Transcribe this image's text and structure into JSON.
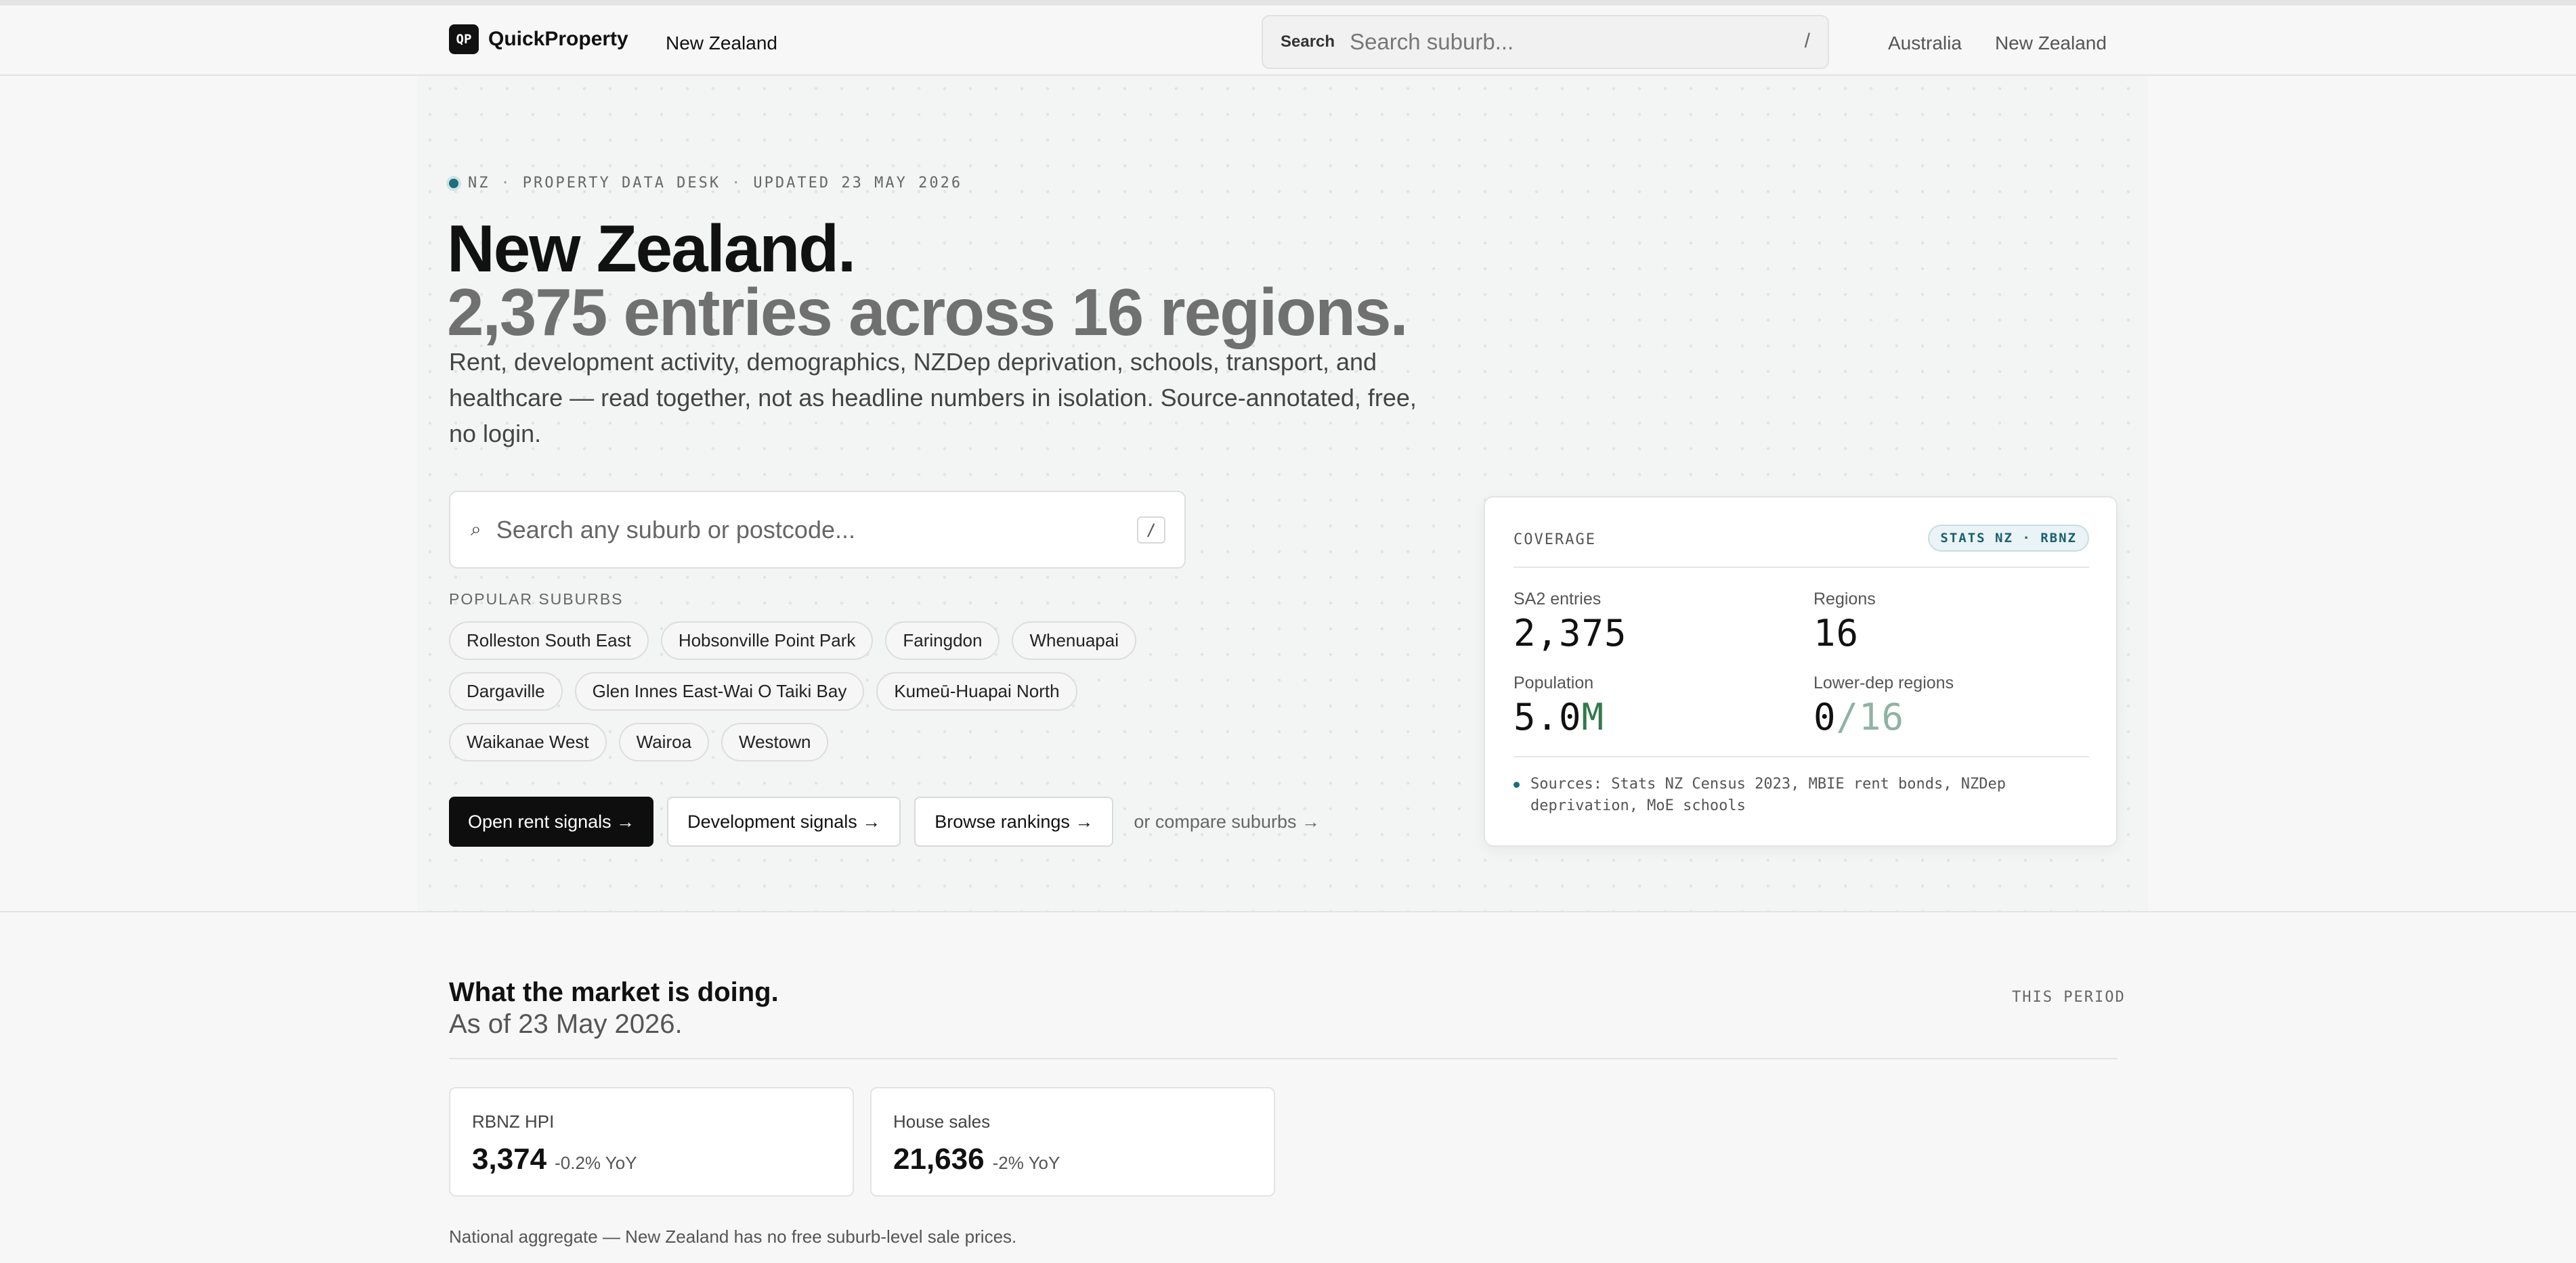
{
  "nav": {
    "brand_logo": "QP",
    "brand_name": "QuickProperty",
    "region": "New Zealand",
    "search_label": "Search",
    "search_placeholder": "Search suburb...",
    "search_shortcut": "/",
    "countries": [
      "Australia",
      "New Zealand"
    ]
  },
  "hero": {
    "eyebrow_parts": [
      "NZ",
      "PROPERTY DATA DESK",
      "UPDATED 23 MAY 2026"
    ],
    "eyebrow_sep": "·",
    "title": "New Zealand.",
    "subtitle": "2,375 entries across 16 regions.",
    "lede": "Rent, development activity, demographics, NZDep deprivation, schools, transport, and healthcare — read together, not as headline numbers in isolation. Source-annotated, free, no login.",
    "search_icon": "⌕",
    "search_placeholder": "Search any suburb or postcode...",
    "search_shortcut": "/",
    "popular_label": "POPULAR SUBURBS",
    "popular_suburbs": [
      [
        "Rolleston South East",
        "Hobsonville Point Park",
        "Faringdon",
        "Whenuapai"
      ],
      [
        "Dargaville",
        "Glen Innes East-Wai O Taiki Bay",
        "Kumeū-Huapai North"
      ],
      [
        "Waikanae West",
        "Wairoa",
        "Westown"
      ]
    ],
    "buttons": {
      "rent": "Open rent signals →",
      "development": "Development signals →",
      "rankings": "Browse rankings →"
    },
    "compare_link": "or compare suburbs →"
  },
  "coverage": {
    "heading": "COVERAGE",
    "badge": "STATS NZ · RBNZ",
    "stats": {
      "sa2_label": "SA2 entries",
      "sa2_value": "2,375",
      "regions_label": "Regions",
      "regions_value": "16",
      "population_label": "Population",
      "population_number": "5.0",
      "population_unit": "M",
      "lowdep_label": "Lower-dep regions",
      "lowdep_value": "0",
      "lowdep_total": "/16"
    },
    "sources": "Sources: Stats NZ Census 2023, MBIE rent bonds, NZDep deprivation, MoE schools"
  },
  "market": {
    "title": "What the market is doing.",
    "subtitle": "As of 23 May 2026.",
    "tag": "THIS PERIOD",
    "cards": [
      {
        "label": "RBNZ HPI",
        "value": "3,374",
        "change": "-0.2% YoY"
      },
      {
        "label": "House sales",
        "value": "21,636",
        "change": "-2% YoY"
      }
    ],
    "footnote": "National aggregate — New Zealand has no free suburb-level sale prices."
  },
  "colors": {
    "accent_teal": "#1b6e7c",
    "accent_green": "#2f7a4c",
    "primary_button": "#0e0e0e",
    "background": "#f7f7f7"
  }
}
